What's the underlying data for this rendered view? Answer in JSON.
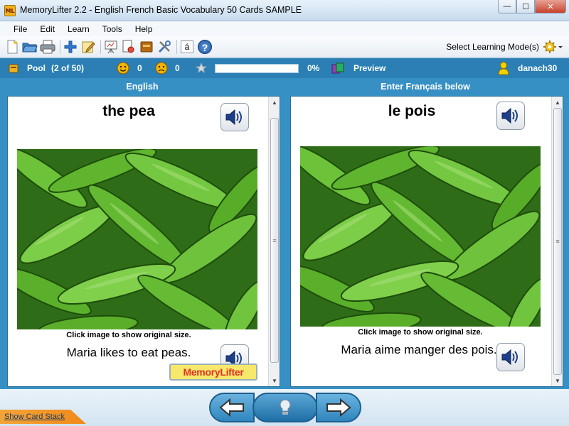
{
  "window": {
    "app_icon_text": "ML",
    "title": "MemoryLifter 2.2 - English French Basic Vocabulary 50 Cards SAMPLE",
    "minimize_glyph": "—",
    "maximize_glyph": "☐",
    "close_glyph": "✕"
  },
  "menu": [
    "File",
    "Edit",
    "Learn",
    "Tools",
    "Help"
  ],
  "toolbar": {
    "icons": [
      "new-document-icon",
      "open-folder-icon",
      "print-icon",
      "add-card-icon",
      "edit-card-icon",
      "presentation-icon",
      "print-preview-icon",
      "box-icon",
      "tools-icon",
      "character-map-icon",
      "help-icon"
    ],
    "char_map_glyph": "á",
    "help_glyph": "?",
    "learning_mode_label": "Select Learning Mode(s)"
  },
  "status": {
    "pool_label": "Pool",
    "pool_count": "(2 of 50)",
    "correct_count": "0",
    "wrong_count": "0",
    "progress_percent_text": "0%",
    "progress_fraction": 0.0,
    "preview_label": "Preview",
    "user_name": "danach30"
  },
  "question": {
    "header": "English",
    "word": "the pea",
    "caption": "Click image to show original size.",
    "sentence": "Maria likes to eat peas."
  },
  "answer": {
    "header": "Enter Français below",
    "word": "le pois",
    "caption": "Click image to show original size.",
    "sentence": "Maria aime manger des pois."
  },
  "watermark_text": "MemoryLifter",
  "scrollbar_glyph": "≡",
  "bottom": {
    "show_card_stack": "Show Card Stack"
  },
  "colors": {
    "accent_blue": "#3690c4",
    "status_blue": "#2b7fb4",
    "pea_green": "#5cb82a"
  }
}
